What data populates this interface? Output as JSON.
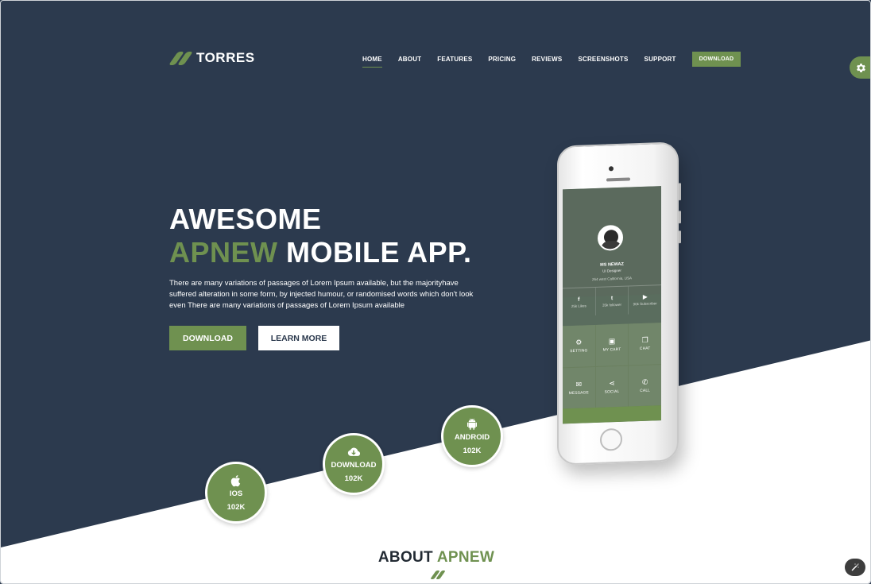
{
  "brand": {
    "name": "TORRES",
    "accent": "#6f9150",
    "dark": "#2c3a4e"
  },
  "nav": {
    "items": [
      "HOME",
      "ABOUT",
      "FEATURES",
      "PRICING",
      "REVIEWS",
      "SCREENSHOTS",
      "SUPPORT"
    ],
    "cta": "DOWNLOAD",
    "active": "HOME"
  },
  "settings": {
    "icon": "gear-icon"
  },
  "hero": {
    "line1": "AWESOME",
    "accent_word": "APNEW",
    "line2_rest": " MOBILE APP.",
    "description": "There are many variations of passages of Lorem Ipsum available, but the majorityhave suffered alteration in some form, by injected humour, or randomised words which don't look even There are many variations of passages of Lorem Ipsum available",
    "download_label": "DOWNLOAD",
    "learn_more_label": "LEARN MORE"
  },
  "stats": [
    {
      "label": "IOS",
      "count": "102K",
      "icon": "apple-icon"
    },
    {
      "label": "DOWNLOAD",
      "count": "102K",
      "icon": "cloud-download-icon"
    },
    {
      "label": "ANDROID",
      "count": "102K",
      "icon": "android-icon"
    }
  ],
  "phone": {
    "profile_name": "MS NEWAZ",
    "profile_role": "UI Designer",
    "profile_location": "264 west California, USA",
    "social": [
      {
        "icon": "f",
        "count": "25k Likes"
      },
      {
        "icon": "t",
        "count": "35k follower"
      },
      {
        "icon": "▶",
        "count": "90k Subscriber"
      }
    ],
    "tiles": [
      {
        "label": "SETTING",
        "icon": "⚙"
      },
      {
        "label": "MY CART",
        "icon": "▣"
      },
      {
        "label": "CHAT",
        "icon": "❐"
      },
      {
        "label": "MESSAGE",
        "icon": "✉"
      },
      {
        "label": "SOCIAL",
        "icon": "⋖"
      },
      {
        "label": "CALL",
        "icon": "✆"
      }
    ]
  },
  "about": {
    "word": "ABOUT",
    "accent_word": "APNEW"
  }
}
